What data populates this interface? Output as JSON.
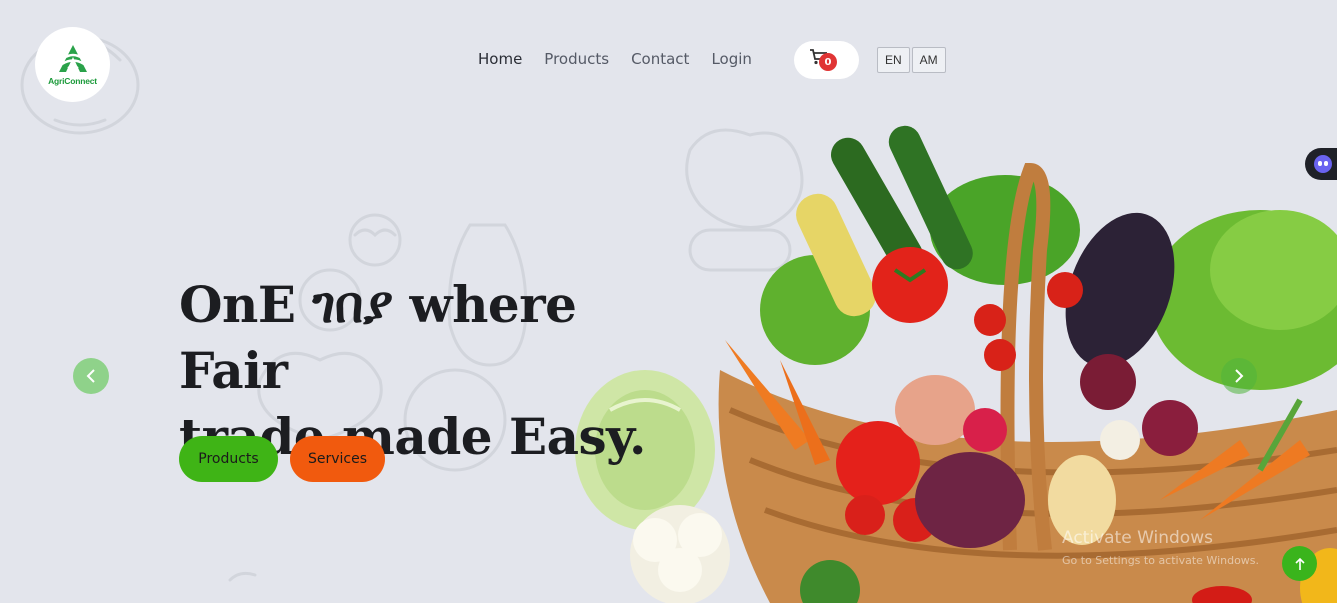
{
  "logo": {
    "name": "AgriConnect",
    "brand_color": "#1b9a3a"
  },
  "nav": {
    "items": [
      {
        "label": "Home",
        "active": true
      },
      {
        "label": "Products",
        "active": false
      },
      {
        "label": "Contact",
        "active": false
      },
      {
        "label": "Login",
        "active": false
      }
    ]
  },
  "cart": {
    "icon": "cart-icon",
    "count": "0",
    "badge_color": "#e03434"
  },
  "language": {
    "options": [
      "EN",
      "AM"
    ]
  },
  "hero": {
    "title_line1": "OnE ገበያ where Fair",
    "title_line2": "trade made Easy.",
    "buttons": {
      "products": "Products",
      "services": "Services"
    },
    "colors": {
      "products": "#3fb416",
      "services": "#f15a0e"
    }
  },
  "carousel": {
    "prev_icon": "chevron-left-icon",
    "next_icon": "chevron-right-icon"
  },
  "watermark": {
    "line1": "Activate Windows",
    "line2": "Go to Settings to activate Windows."
  },
  "scroll_top": {
    "icon": "arrow-up-icon"
  }
}
